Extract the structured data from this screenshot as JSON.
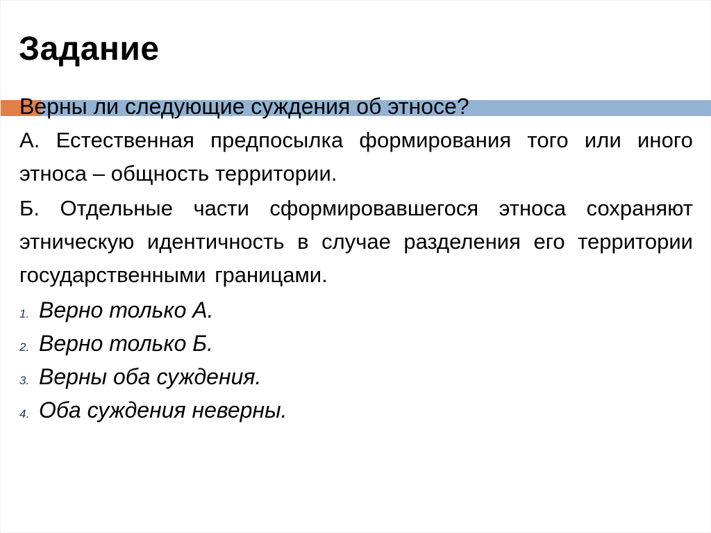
{
  "slide": {
    "title": "Задание",
    "accent_colors": {
      "orange": "#e07f46",
      "blue": "#93b3d3",
      "number_color": "#1f3864"
    },
    "question": "Верны ли следующие суждения об этносе?",
    "statements": [
      {
        "text": "А. Естественная предпосылка формирования того или иного этноса – общность территории."
      },
      {
        "text": "Б. Отдельные части сформировавшегося этноса сохраняют этническую идентичность в случае разделения его территории государственными границами."
      }
    ],
    "options": [
      {
        "number": "1.",
        "text": "Верно только А."
      },
      {
        "number": "2.",
        "text": "Верно только Б."
      },
      {
        "number": "3.",
        "text": "Верны оба суждения."
      },
      {
        "number": "4.",
        "text": "Оба суждения неверны."
      }
    ]
  }
}
